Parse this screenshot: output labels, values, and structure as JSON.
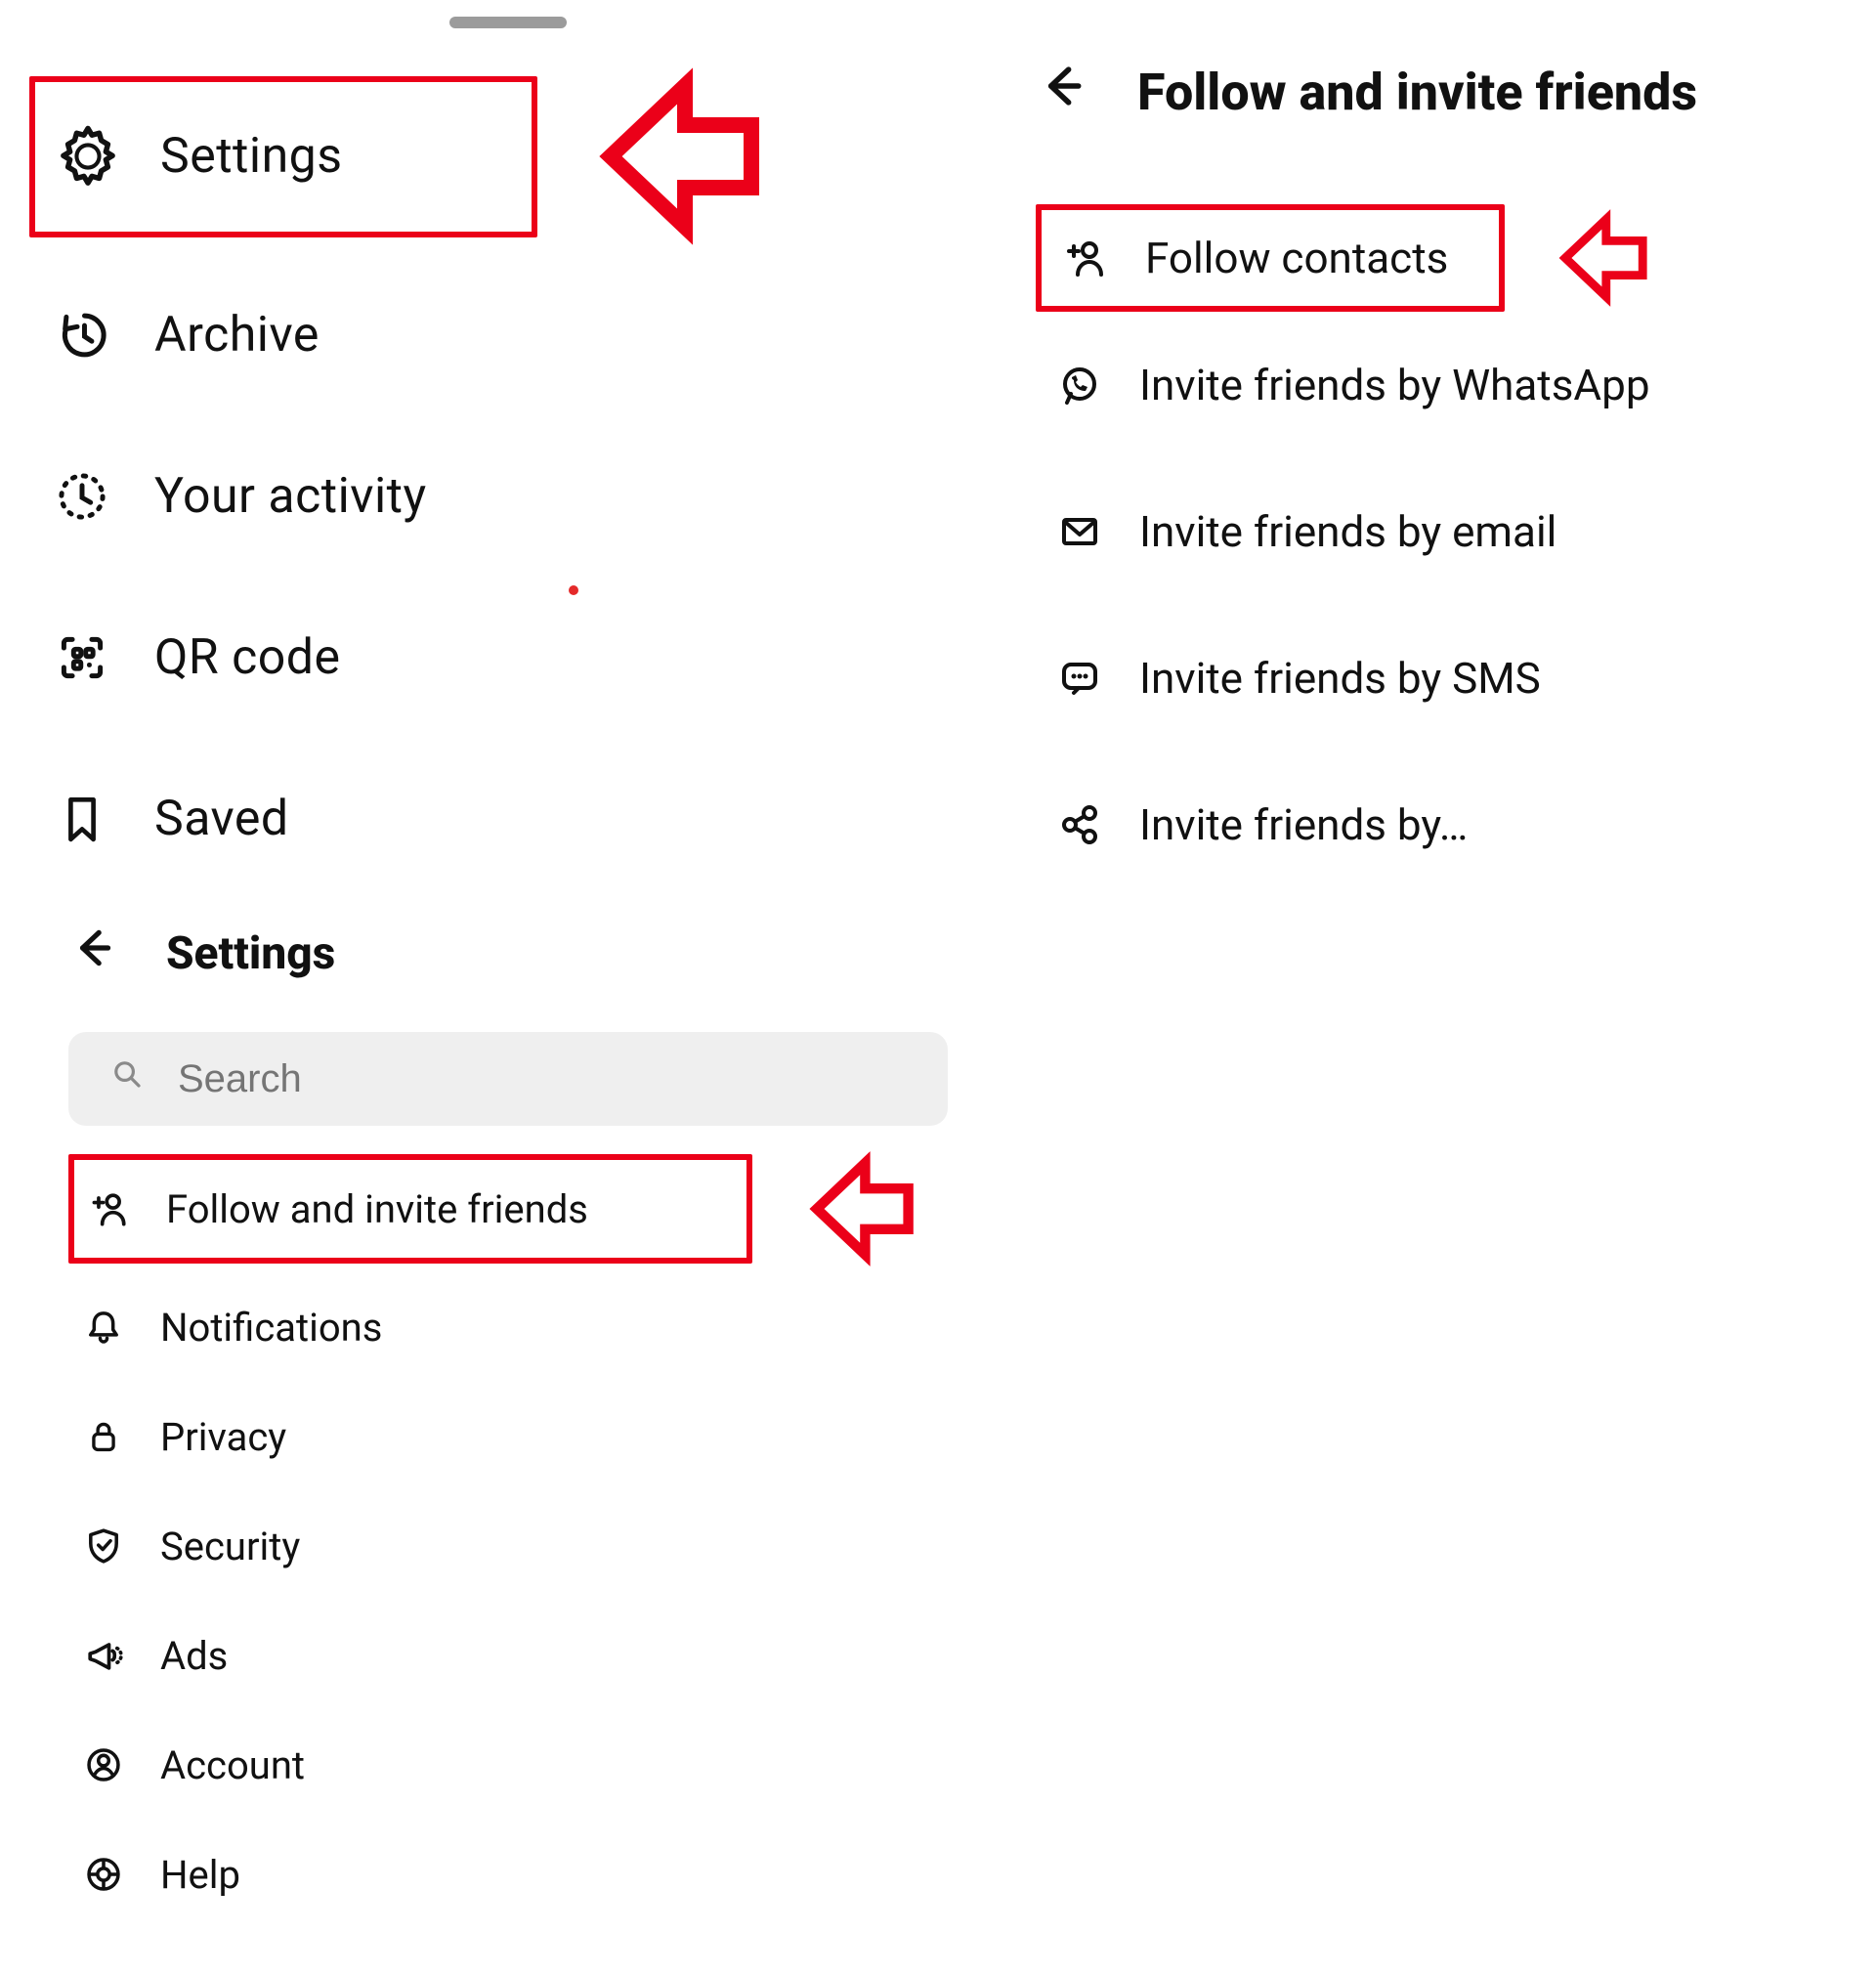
{
  "left_menu": {
    "items": [
      {
        "label": "Settings"
      },
      {
        "label": "Archive"
      },
      {
        "label": "Your activity"
      },
      {
        "label": "QR code"
      },
      {
        "label": "Saved"
      }
    ]
  },
  "settings_panel": {
    "title": "Settings",
    "search_placeholder": "Search",
    "items": [
      {
        "label": "Follow and invite friends"
      },
      {
        "label": "Notifications"
      },
      {
        "label": "Privacy"
      },
      {
        "label": "Security"
      },
      {
        "label": "Ads"
      },
      {
        "label": "Account"
      },
      {
        "label": "Help"
      }
    ]
  },
  "right_panel": {
    "title": "Follow and invite friends",
    "items": [
      {
        "label": "Follow contacts"
      },
      {
        "label": "Invite friends by WhatsApp"
      },
      {
        "label": "Invite friends by email"
      },
      {
        "label": "Invite friends by SMS"
      },
      {
        "label": "Invite friends by…"
      }
    ]
  },
  "colors": {
    "highlight": "#eb0019"
  }
}
